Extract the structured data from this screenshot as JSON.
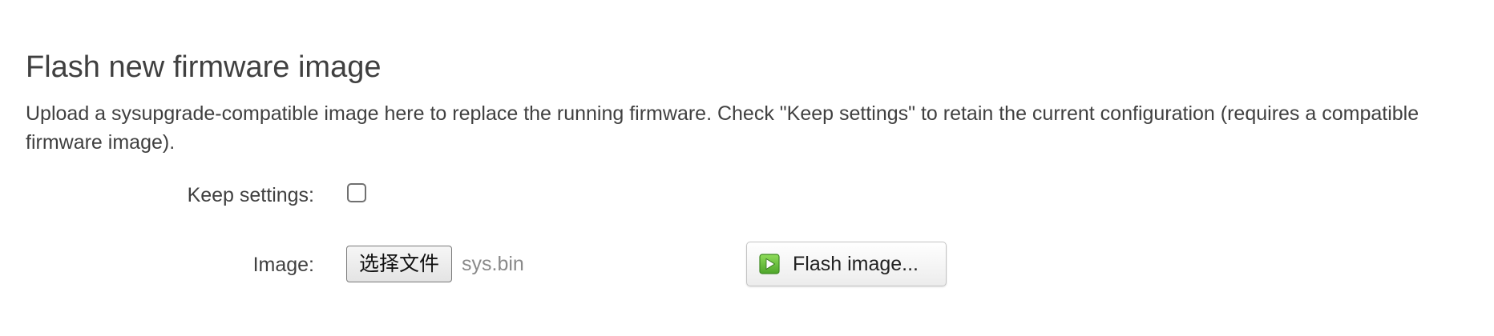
{
  "section": {
    "title": "Flash new firmware image",
    "description": "Upload a sysupgrade-compatible image here to replace the running firmware. Check \"Keep settings\" to retain the current configuration (requires a compatible firmware image)."
  },
  "keep_settings": {
    "label": "Keep settings:",
    "checked": false
  },
  "image": {
    "label": "Image:",
    "choose_file_label": "选择文件",
    "selected_file": "sys.bin"
  },
  "flash_button": {
    "label": "Flash image...",
    "icon": "flash-play-icon",
    "icon_color": "#6dbf3a"
  }
}
